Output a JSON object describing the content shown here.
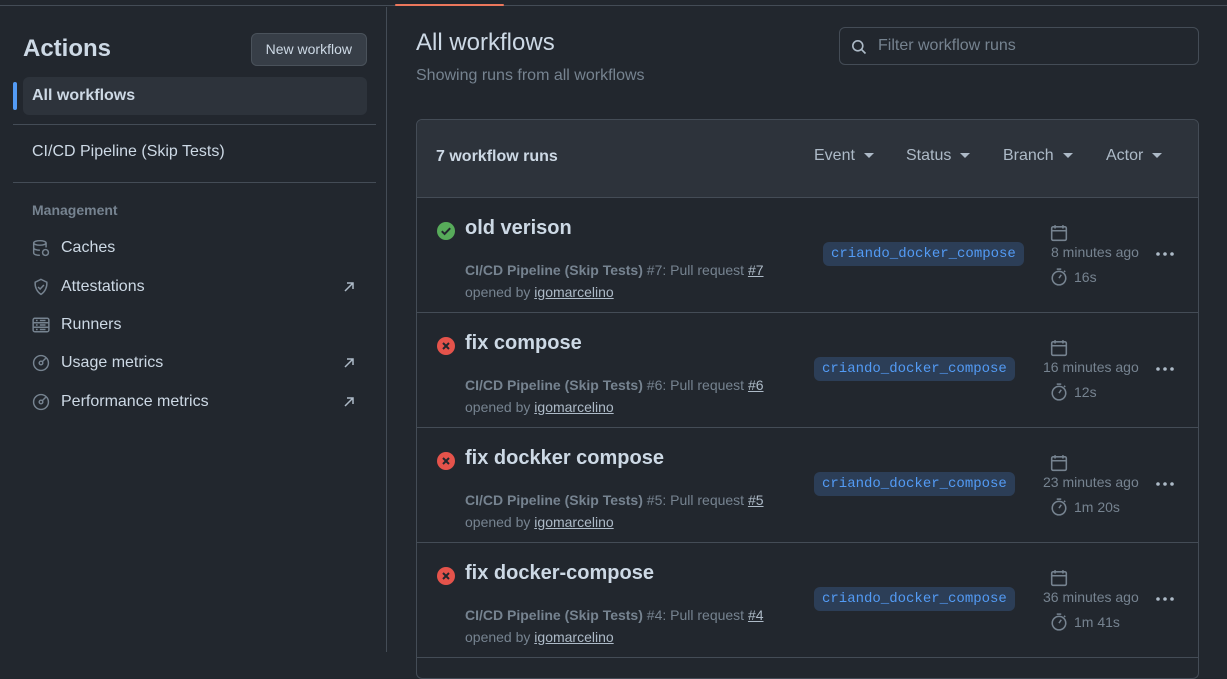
{
  "sidebar": {
    "title": "Actions",
    "new_workflow": "New workflow",
    "all_workflows": "All workflows",
    "workflows": [
      "CI/CD Pipeline (Skip Tests)"
    ],
    "management_label": "Management",
    "management": [
      {
        "label": "Caches",
        "icon": "database-icon",
        "external": false
      },
      {
        "label": "Attestations",
        "icon": "shield-check-icon",
        "external": true
      },
      {
        "label": "Runners",
        "icon": "server-icon",
        "external": false
      },
      {
        "label": "Usage metrics",
        "icon": "meter-icon",
        "external": true
      },
      {
        "label": "Performance metrics",
        "icon": "meter-icon",
        "external": true
      }
    ]
  },
  "main": {
    "title": "All workflows",
    "subtitle": "Showing runs from all workflows",
    "filter_placeholder": "Filter workflow runs",
    "runs_count": "7 workflow runs",
    "filters": [
      "Event",
      "Status",
      "Branch",
      "Actor"
    ],
    "runs": [
      {
        "title": "old verison",
        "status": "success",
        "workflow": "CI/CD Pipeline (Skip Tests)",
        "run_text": " #7: Pull request ",
        "pr": "#7",
        "opened_by": "opened by ",
        "user": "igomarcelino",
        "branch": "criando_docker_compose",
        "time": "8 minutes ago",
        "duration": "16s"
      },
      {
        "title": "fix compose",
        "status": "failure",
        "workflow": "CI/CD Pipeline (Skip Tests)",
        "run_text": " #6: Pull request ",
        "pr": "#6",
        "opened_by": "opened by ",
        "user": "igomarcelino",
        "branch": "criando_docker_compose",
        "time": "16 minutes ago",
        "duration": "12s"
      },
      {
        "title": "fix dockker compose",
        "status": "failure",
        "workflow": "CI/CD Pipeline (Skip Tests)",
        "run_text": " #5: Pull request ",
        "pr": "#5",
        "opened_by": "opened by ",
        "user": "igomarcelino",
        "branch": "criando_docker_compose",
        "time": "23 minutes ago",
        "duration": "1m 20s"
      },
      {
        "title": "fix docker-compose",
        "status": "failure",
        "workflow": "CI/CD Pipeline (Skip Tests)",
        "run_text": " #4: Pull request ",
        "pr": "#4",
        "opened_by": "opened by ",
        "user": "igomarcelino",
        "branch": "criando_docker_compose",
        "time": "36 minutes ago",
        "duration": "1m 41s"
      }
    ]
  },
  "colors": {
    "background": "#22272e",
    "accent": "#539bf5",
    "success": "#57ab5a",
    "failure": "#e5534b",
    "active_tab": "#ec775c"
  }
}
